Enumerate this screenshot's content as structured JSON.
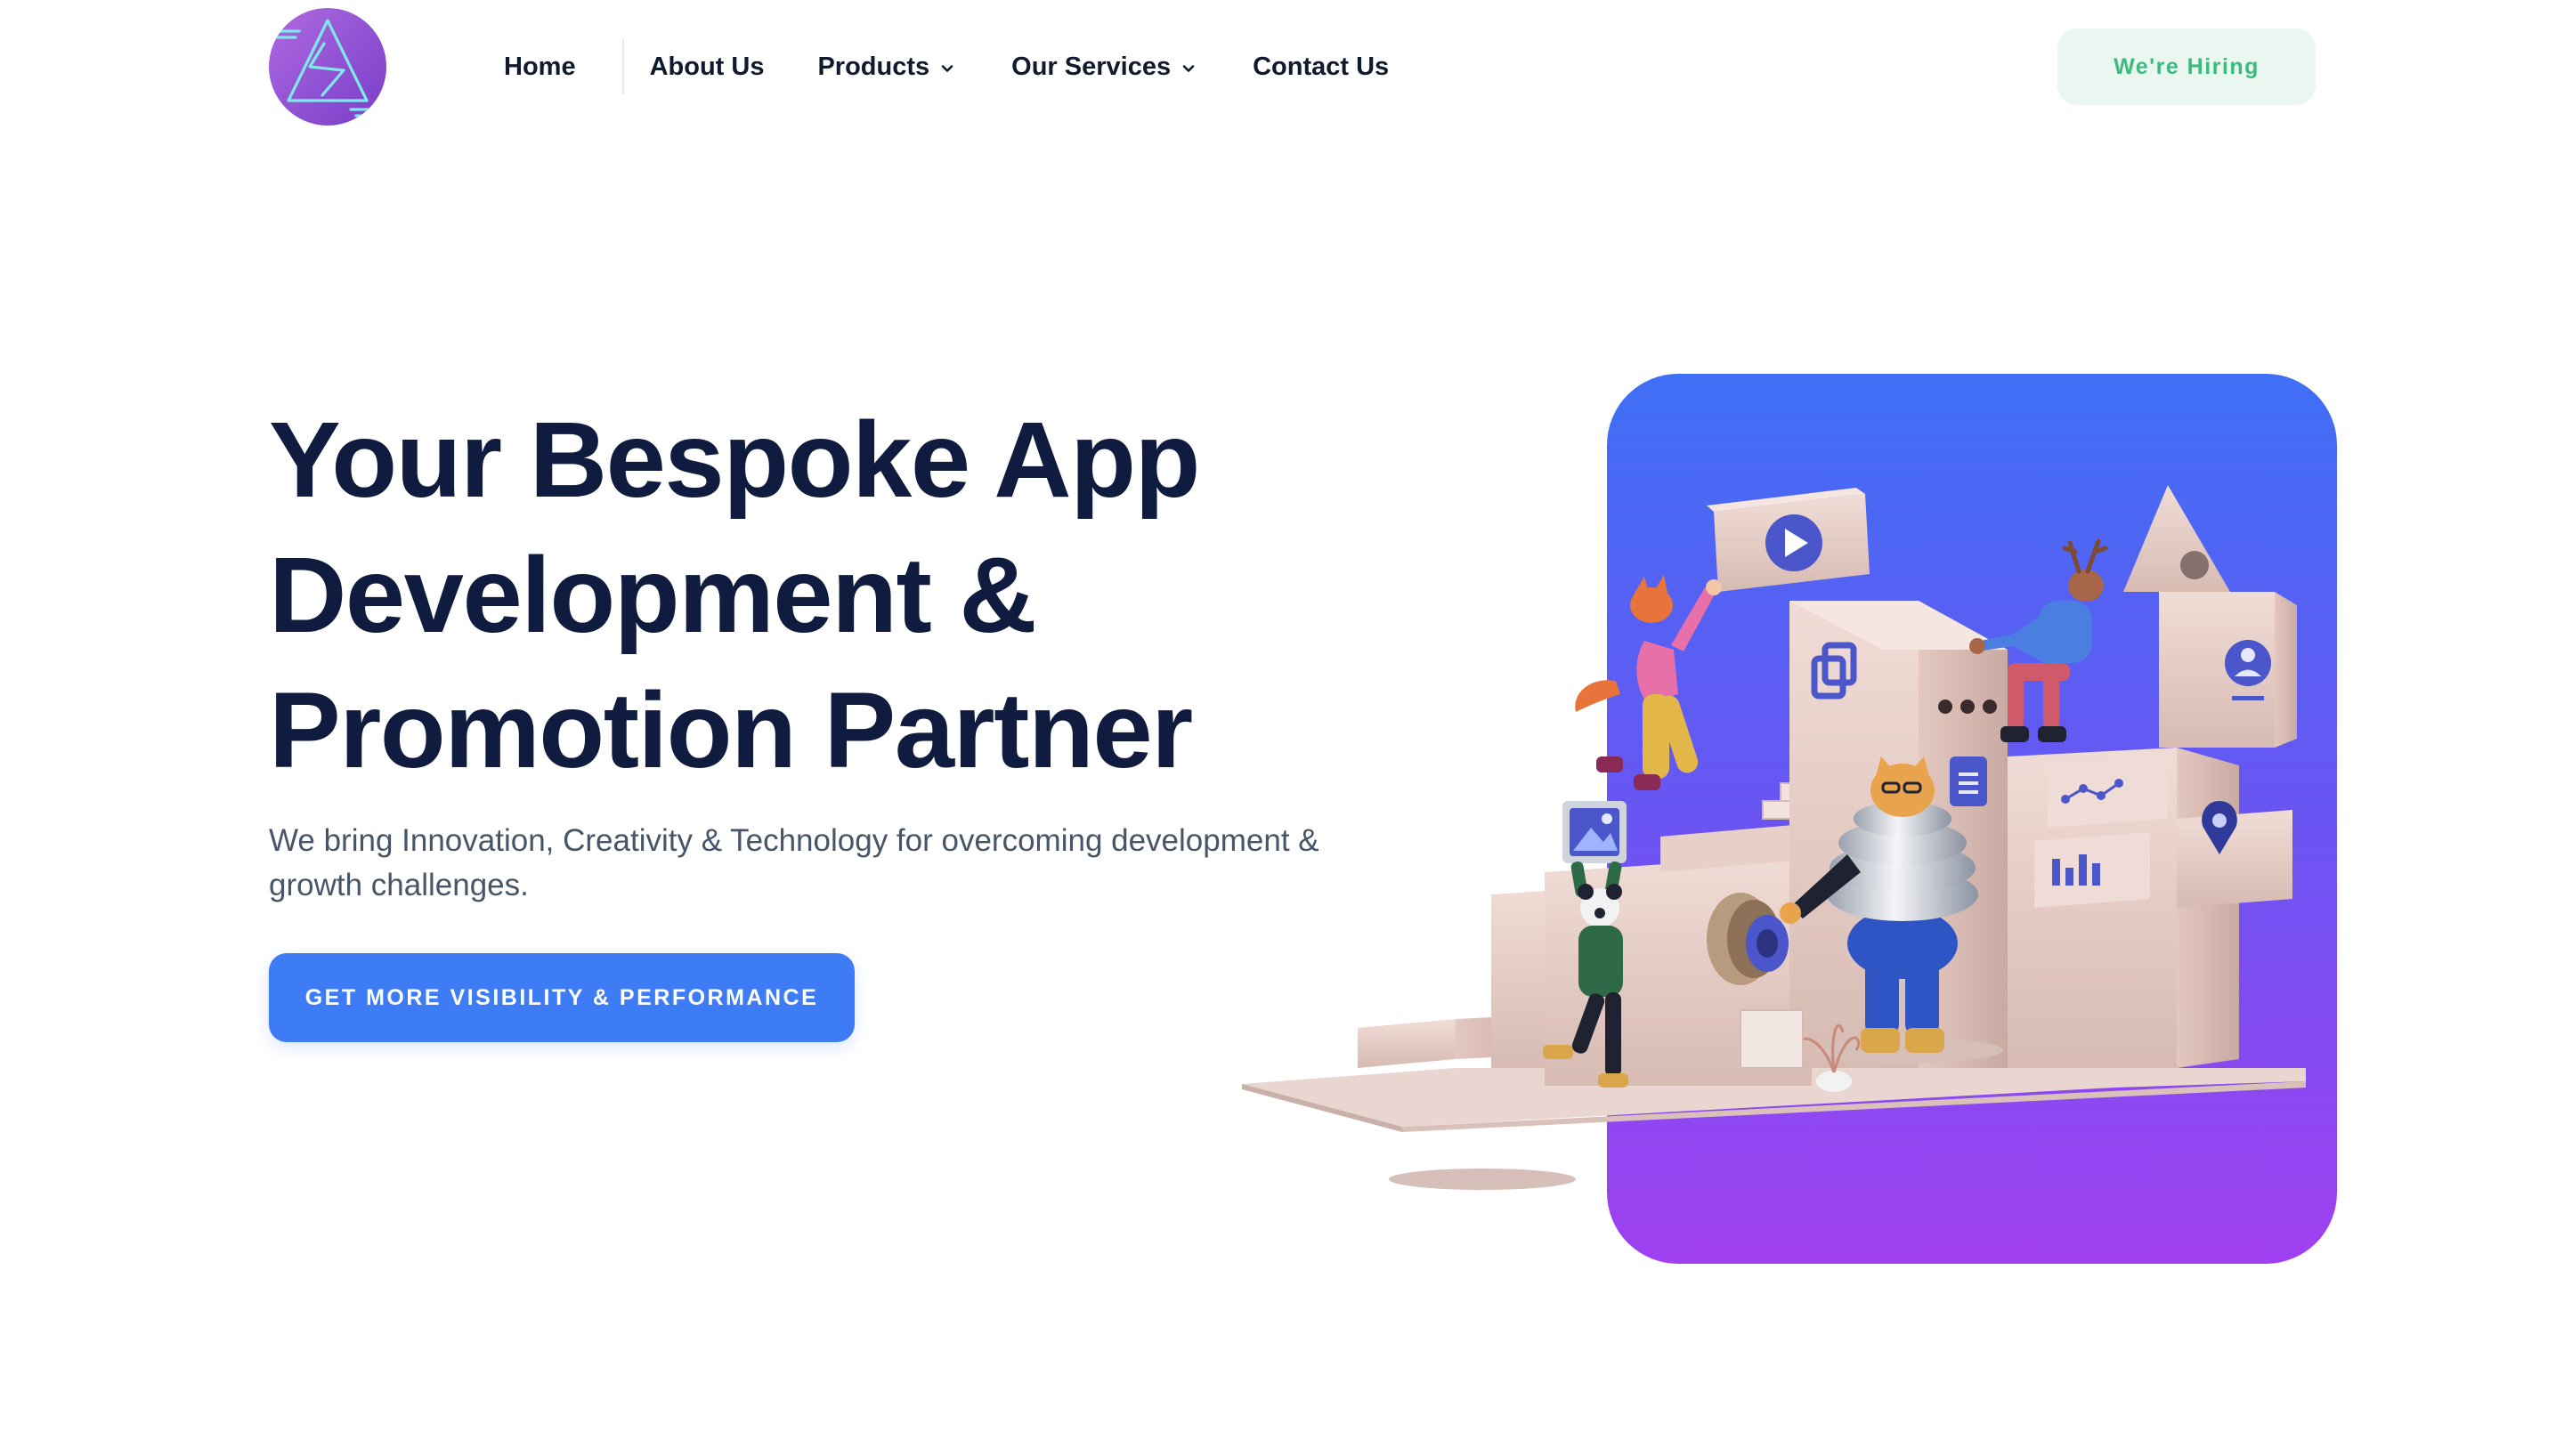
{
  "header": {
    "logo_name": "company-logo",
    "nav": [
      {
        "label": "Home",
        "has_dropdown": false
      },
      {
        "label": "About Us",
        "has_dropdown": false
      },
      {
        "label": "Products",
        "has_dropdown": true
      },
      {
        "label": "Our Services",
        "has_dropdown": true
      },
      {
        "label": "Contact Us",
        "has_dropdown": false
      }
    ],
    "hiring_label": "We're Hiring"
  },
  "hero": {
    "title_lines": [
      "Your Bespoke App",
      "Development &",
      "Promotion Partner"
    ],
    "subtitle": "We bring Innovation, Creativity & Technology for overcoming development & growth challenges.",
    "cta_label": "GET MORE VISIBILITY & PERFORMANCE",
    "illustration": "3d-team-building-blocks-illustration"
  },
  "colors": {
    "title": "#0f1c3f",
    "nav_text": "#101a2e",
    "subtitle": "#475569",
    "cta_bg": "#3d7cf5",
    "hiring_bg": "#e9f7f0",
    "hiring_text": "#3dba7d",
    "logo_purple": "#9b5de5",
    "art_gradient_top": "#3f6ff5",
    "art_gradient_bottom": "#a040f0"
  },
  "icons": {
    "dropdown": "chevron-down-icon",
    "media": [
      "play-icon",
      "copy-icon",
      "document-icon",
      "chart-icon",
      "location-pin-icon",
      "user-profile-icon",
      "image-icon"
    ]
  }
}
